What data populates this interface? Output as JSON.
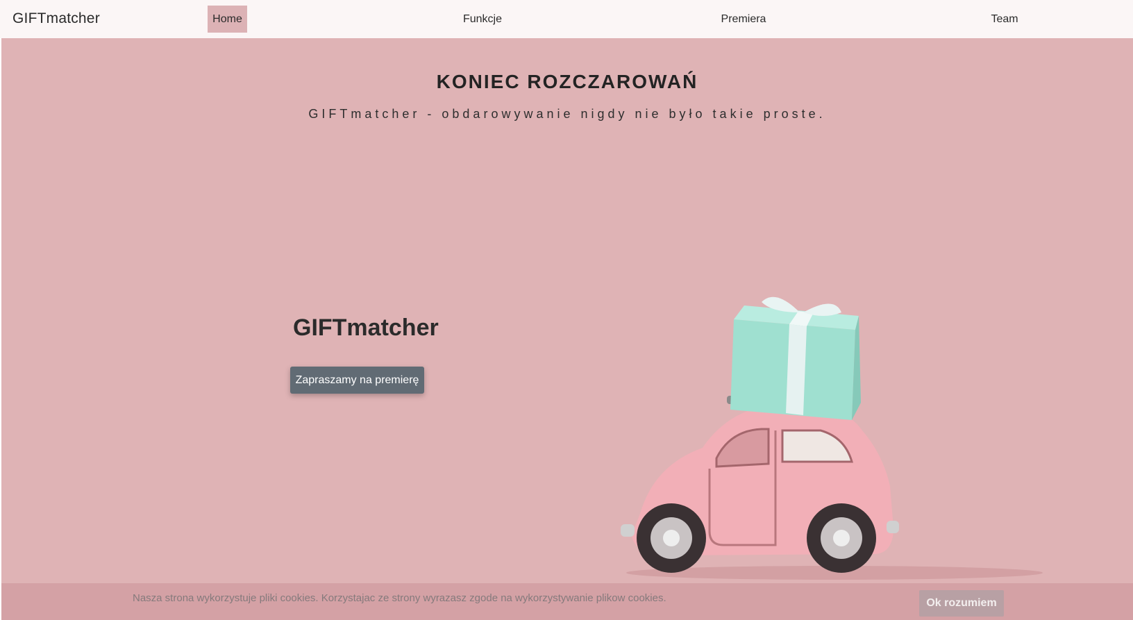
{
  "navbar": {
    "brand": "GIFTmatcher",
    "items": [
      {
        "label": "Home",
        "active": true
      },
      {
        "label": "Funkcje",
        "active": false
      },
      {
        "label": "Premiera",
        "active": false
      },
      {
        "label": "Team",
        "active": false
      }
    ]
  },
  "hero": {
    "title": "KONIEC ROZCZAROWAŃ",
    "subtitle": "GIFTmatcher - obdarowywanie nigdy nie było takie proste.",
    "left_title": "GIFTmatcher",
    "cta_label": "Zapraszamy na premierę",
    "image_icon": "pink-car-with-gift-icon"
  },
  "cookie": {
    "text": "Nasza strona wykorzystuje pliki cookies. Korzystajac ze strony wyrazasz zgode na wykorzystywanie plikow cookies.",
    "button_label": "Ok rozumiem"
  },
  "colors": {
    "hero_bg": "#dfb3b5",
    "nav_active": "#dcb2b5",
    "cta": "#616b74",
    "cookie_bar": "#d4a1a5",
    "gift": "#9fe0d0",
    "car": "#f1aeb6"
  }
}
